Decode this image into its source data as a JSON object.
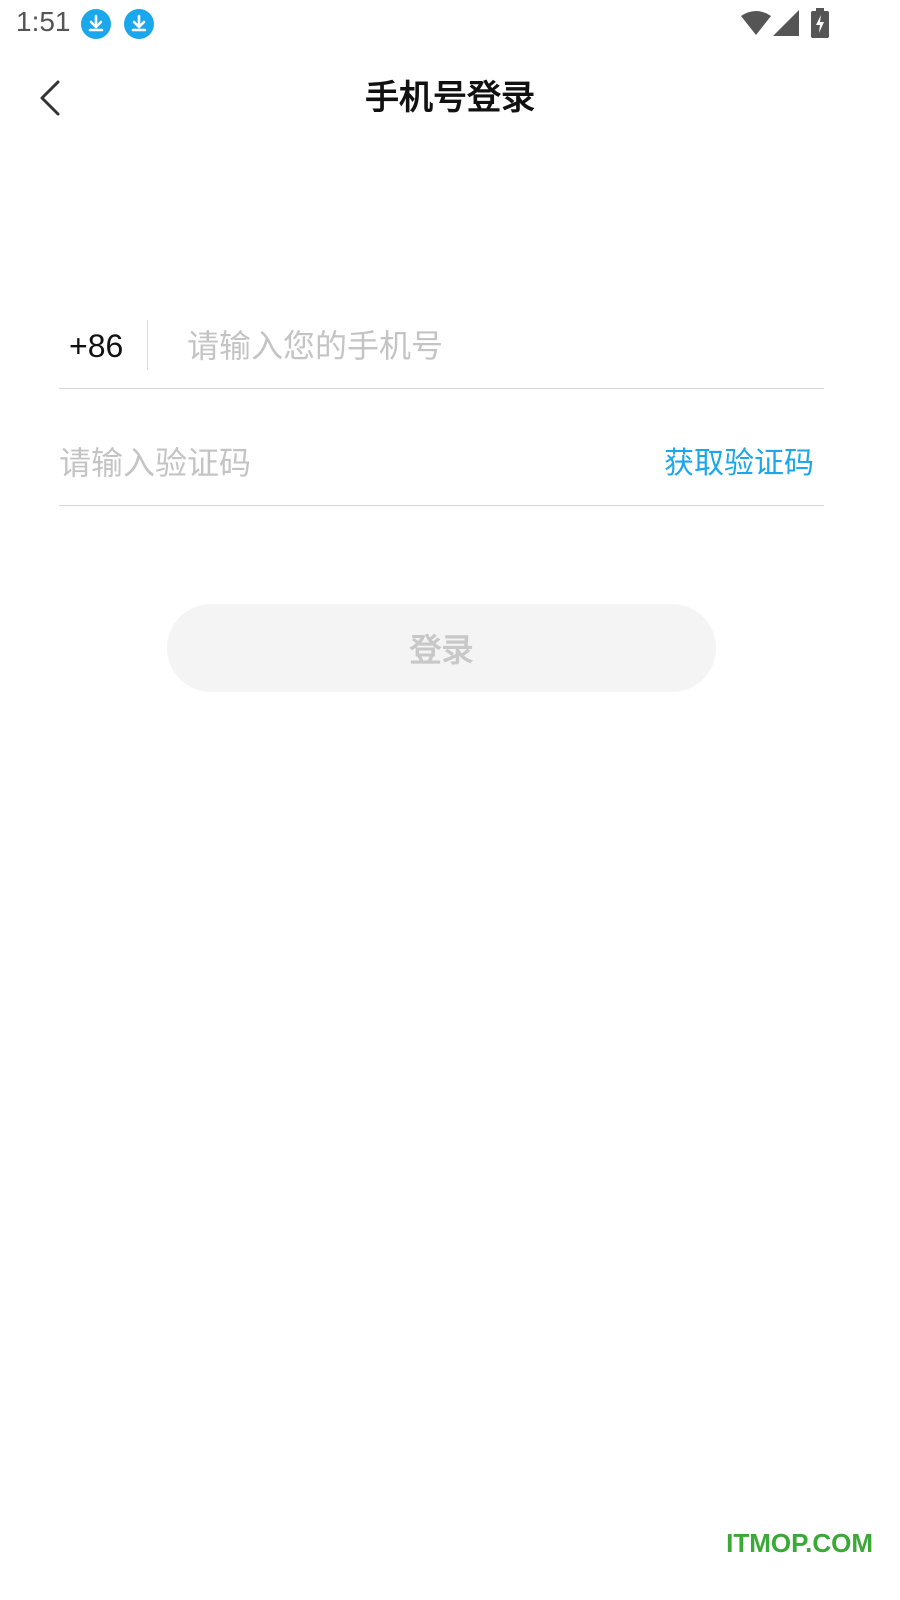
{
  "status_bar": {
    "time": "1:51",
    "icons": [
      "download-icon",
      "download-icon",
      "wifi-icon",
      "cell-signal-icon",
      "battery-charging-icon"
    ],
    "accent_color": "#1aa7ec"
  },
  "nav": {
    "title": "手机号登录",
    "back_icon": "chevron-left-icon"
  },
  "form": {
    "country_code": "+86",
    "phone_value": "",
    "phone_placeholder": "请输入您的手机号",
    "code_value": "",
    "code_placeholder": "请输入验证码",
    "get_code_label": "获取验证码",
    "login_label": "登录",
    "link_color": "#1aa7ec",
    "login_disabled": true
  },
  "watermark": {
    "text": "ITMOP.COM",
    "color": "#3aa935"
  }
}
